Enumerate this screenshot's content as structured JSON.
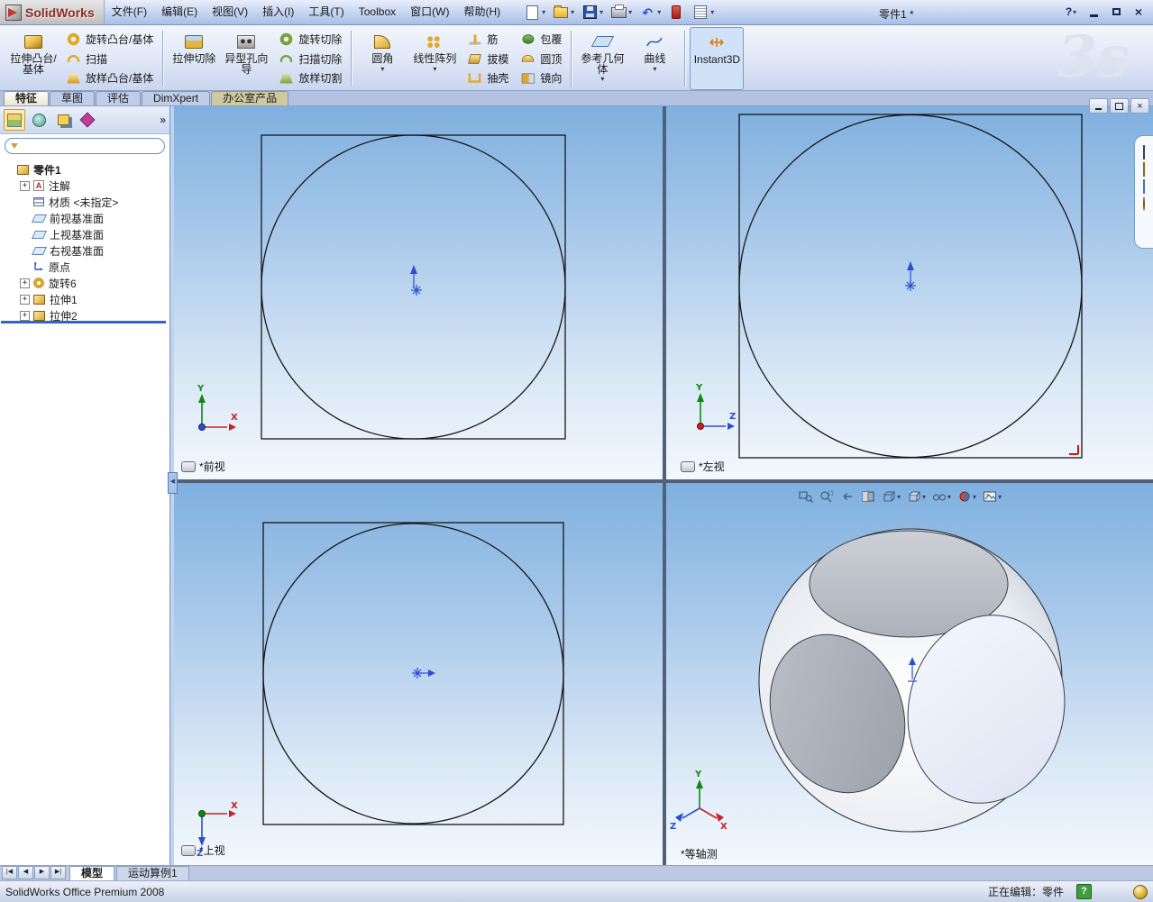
{
  "colors": {
    "titlebar": "#c4d4f0",
    "logo_text": "#8d2a20",
    "viewport_gradient_top": "#7fb0df",
    "viewport_gradient_bottom": "#f3f8fd",
    "rollback_bar": "#2f66c8",
    "status_help_green": "#3f9d3f",
    "sketch_line": "#161616",
    "axis_x_red": "#cc2020",
    "axis_y_green": "#0c8a12",
    "axis_z_blue": "#2a4fd0"
  },
  "tb": {
    "logo": "SolidWorks",
    "menus": [
      "文件(F)",
      "编辑(E)",
      "视图(V)",
      "插入(I)",
      "工具(T)",
      "Toolbox",
      "窗口(W)",
      "帮助(H)"
    ],
    "doc_title": "零件1 *"
  },
  "wc": {
    "help": "?",
    "close": "×"
  },
  "g": {
    "dropdown": "▾",
    "plus": "+",
    "chevron": "»",
    "splitter": "◀",
    "undo": "↶"
  },
  "wm": "3s",
  "cm": {
    "large": [
      {
        "label": "拉伸凸台/基体"
      },
      {
        "label": "拉伸切除"
      },
      {
        "label": "异型孔向导"
      },
      {
        "label": "圆角"
      },
      {
        "label": "线性阵列"
      },
      {
        "label": "参考几何体"
      },
      {
        "label": "曲线"
      },
      {
        "label": "Instant3D"
      }
    ],
    "small": [
      {
        "label": "旋转凸台/基体"
      },
      {
        "label": "扫描"
      },
      {
        "label": "放样凸台/基体"
      },
      {
        "label": "旋转切除"
      },
      {
        "label": "扫描切除"
      },
      {
        "label": "放样切割"
      },
      {
        "label": "筋"
      },
      {
        "label": "拔模"
      },
      {
        "label": "抽壳"
      },
      {
        "label": "包覆"
      },
      {
        "label": "圆顶"
      },
      {
        "label": "镜向"
      }
    ]
  },
  "tabs": {
    "items": [
      "特征",
      "草图",
      "评估",
      "DimXpert",
      "办公室产品"
    ],
    "active": "特征"
  },
  "tree": [
    {
      "label": "零件1"
    },
    {
      "label": "注解"
    },
    {
      "label": "材质 <未指定>"
    },
    {
      "label": "前视基准面"
    },
    {
      "label": "上视基准面"
    },
    {
      "label": "右视基准面"
    },
    {
      "label": "原点"
    },
    {
      "label": "旋转6"
    },
    {
      "label": "拉伸1"
    },
    {
      "label": "拉伸2"
    }
  ],
  "filter": {
    "value": ""
  },
  "vp": {
    "front": {
      "label": "*前视"
    },
    "left": {
      "label": "*左视"
    },
    "top": {
      "label": "*上视"
    },
    "iso": {
      "label": "*等轴测"
    }
  },
  "ax": {
    "x": "X",
    "y": "Y",
    "z": "Z"
  },
  "ann": "A",
  "bt": {
    "vcr": [
      "|◀",
      "◀",
      "▶",
      "▶|"
    ],
    "tabs": [
      "模型",
      "运动算例1"
    ],
    "active": "模型"
  },
  "sb": {
    "left": "SolidWorks Office Premium 2008",
    "right": "正在编辑：零件",
    "help": "?"
  }
}
